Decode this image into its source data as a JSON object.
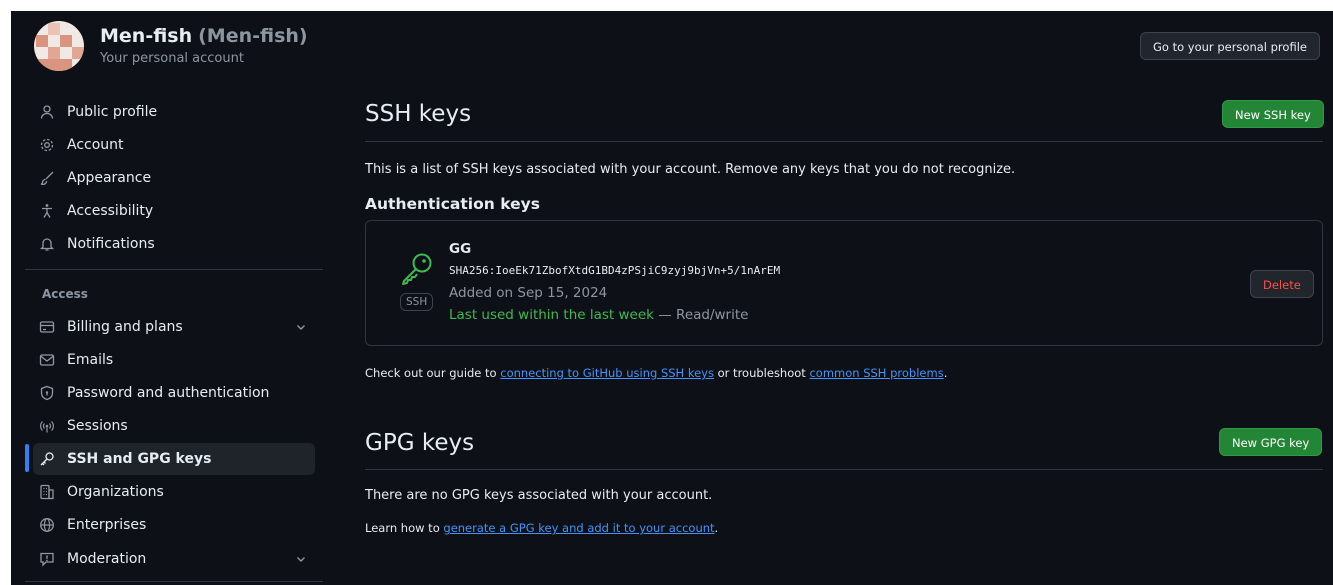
{
  "account": {
    "name": "Men-fish",
    "handle": "(Men-fish)",
    "subtitle": "Your personal account",
    "profile_button": "Go to your personal profile"
  },
  "sidebar": {
    "items_top": [
      {
        "label": "Public profile",
        "icon": "person-icon"
      },
      {
        "label": "Account",
        "icon": "gear-icon"
      },
      {
        "label": "Appearance",
        "icon": "paintbrush-icon"
      },
      {
        "label": "Accessibility",
        "icon": "accessibility-icon"
      },
      {
        "label": "Notifications",
        "icon": "bell-icon"
      }
    ],
    "access_heading": "Access",
    "items_access": [
      {
        "label": "Billing and plans",
        "icon": "credit-card-icon"
      },
      {
        "label": "Emails",
        "icon": "mail-icon"
      },
      {
        "label": "Password and authentication",
        "icon": "shield-lock-icon"
      },
      {
        "label": "Sessions",
        "icon": "broadcast-icon"
      },
      {
        "label": "SSH and GPG keys",
        "icon": "key-icon"
      },
      {
        "label": "Organizations",
        "icon": "organization-icon"
      },
      {
        "label": "Enterprises",
        "icon": "globe-icon"
      },
      {
        "label": "Moderation",
        "icon": "report-icon"
      }
    ]
  },
  "ssh": {
    "title": "SSH keys",
    "new_button": "New SSH key",
    "description": "This is a list of SSH keys associated with your account. Remove any keys that you do not recognize.",
    "auth_heading": "Authentication keys",
    "key": {
      "title": "GG",
      "badge": "SSH",
      "fingerprint": "SHA256:IoeEk71ZbofXtdG1BD4zPSjiC9zyj9bjVn+5/1nArEM",
      "added": "Added on Sep 15, 2024",
      "last_used": "Last used within the last week",
      "access": " — Read/write",
      "delete_button": "Delete"
    },
    "guide_prefix": "Check out our guide to ",
    "guide_link": "connecting to GitHub using SSH keys",
    "guide_middle": " or troubleshoot ",
    "guide_link2": "common SSH problems",
    "guide_suffix": "."
  },
  "gpg": {
    "title": "GPG keys",
    "new_button": "New GPG key",
    "empty": "There are no GPG keys associated with your account.",
    "learn_prefix": "Learn how to ",
    "learn_link": "generate a GPG key and add it to your account",
    "learn_suffix": "."
  },
  "colors": {
    "background": "#0d1117",
    "accent_blue": "#2f81f7",
    "green_button": "#238636",
    "danger": "#f85149",
    "success_text": "#3fb950"
  }
}
